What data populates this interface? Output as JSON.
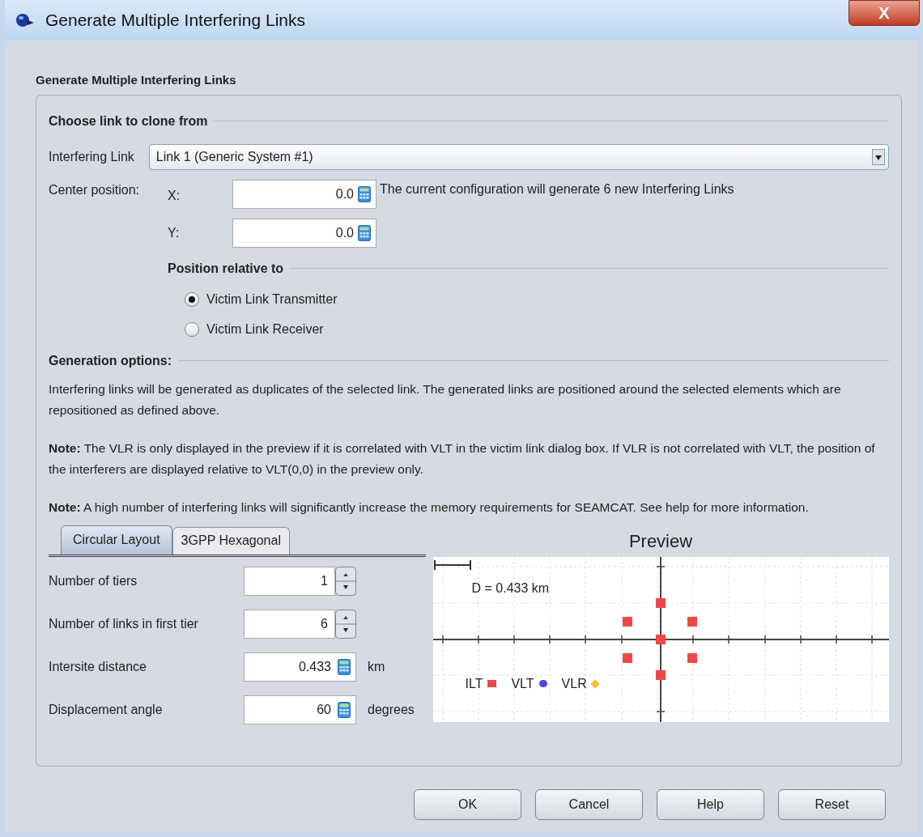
{
  "window": {
    "title": "Generate Multiple Interfering Links",
    "close": "X"
  },
  "group_title": "Generate Multiple Interfering Links",
  "clone_section": {
    "heading": "Choose link to clone from",
    "link_label": "Interfering Link",
    "link_value": "Link 1 (Generic System #1)"
  },
  "center": {
    "label": "Center position:",
    "x_label": "X:",
    "x_value": "0.0",
    "y_label": "Y:",
    "y_value": "0.0",
    "info": "The current configuration will generate 6 new Interfering Links"
  },
  "relative": {
    "heading": "Position relative to",
    "options": [
      {
        "label": "Victim Link Transmitter",
        "selected": true
      },
      {
        "label": "Victim Link Receiver",
        "selected": false
      }
    ]
  },
  "generation": {
    "heading": "Generation options:",
    "paragraphs": [
      "Interfering links will be generated as duplicates of the selected link. The generated links are positioned around the selected elements which are repositioned as defined above.",
      "**Note:** The VLR is only displayed in the preview if it is correlated with VLT in the victim link dialog box. If VLR is not correlated with VLT, the position of the interferers are displayed relative to VLT(0,0) in the preview only.",
      "**Note:** A high number of interfering links will significantly increase the memory requirements for SEAMCAT. See help for more information."
    ]
  },
  "tabs": [
    {
      "label": "Circular Layout",
      "selected": true
    },
    {
      "label": "3GPP Hexagonal",
      "selected": false
    }
  ],
  "fields": [
    {
      "kind": "spinner",
      "label": "Number of tiers",
      "value": "1"
    },
    {
      "kind": "spinner",
      "label": "Number of links in first tier",
      "value": "6"
    },
    {
      "kind": "calc",
      "label": "Intersite distance",
      "value": "0.433",
      "unit": "km"
    },
    {
      "kind": "calc",
      "label": "Displacement angle",
      "value": "60",
      "unit": "degrees"
    }
  ],
  "preview": {
    "title": "Preview",
    "scale_label": "D = 0.433 km",
    "legend": [
      {
        "label": "ILT",
        "color": "#f04848"
      },
      {
        "label": "VLT",
        "color": "#4848f0"
      },
      {
        "label": "VLR",
        "color": "#f8c030"
      }
    ]
  },
  "buttons": [
    "OK",
    "Cancel",
    "Help",
    "Reset"
  ]
}
